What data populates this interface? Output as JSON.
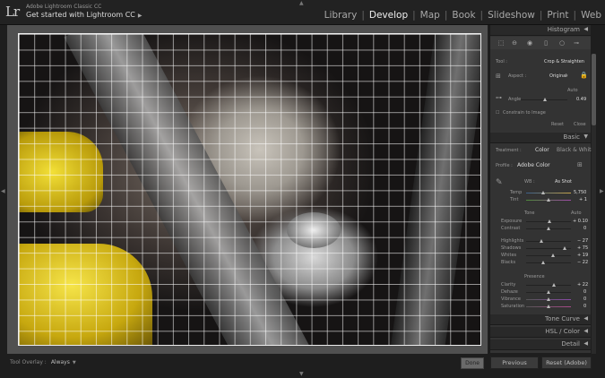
{
  "app": {
    "logo": "Lr",
    "name": "Adobe Lightroom Classic CC",
    "promo": "Get started with Lightroom CC"
  },
  "modules": [
    {
      "label": "Library",
      "active": false
    },
    {
      "label": "Develop",
      "active": true
    },
    {
      "label": "Map",
      "active": false
    },
    {
      "label": "Book",
      "active": false
    },
    {
      "label": "Slideshow",
      "active": false
    },
    {
      "label": "Print",
      "active": false
    },
    {
      "label": "Web",
      "active": false
    }
  ],
  "bottom_bar": {
    "tool_overlay_label": "Tool Overlay :",
    "tool_overlay_value": "Always",
    "done_label": "Done"
  },
  "panel": {
    "histogram": "Histogram",
    "crop": {
      "tool_label": "Tool :",
      "tool_value": "Crop & Straighten",
      "aspect_label": "Aspect :",
      "aspect_value": "Original",
      "auto_label": "Auto",
      "angle_label": "Angle",
      "angle_value": "0.49",
      "constrain_label": "Constrain to Image",
      "reset_label": "Reset",
      "close_label": "Close"
    },
    "basic": {
      "title": "Basic",
      "treatment_label": "Treatment :",
      "color_label": "Color",
      "bw_label": "Black & White",
      "profile_label": "Profile :",
      "profile_value": "Adobe Color",
      "wb_label": "WB :",
      "wb_value": "As Shot",
      "temp_label": "Temp",
      "temp_value": "5,750",
      "tint_label": "Tint",
      "tint_value": "+ 1",
      "tone_label": "Tone",
      "tone_auto": "Auto",
      "exposure_label": "Exposure",
      "exposure_value": "+ 0.10",
      "contrast_label": "Contrast",
      "contrast_value": "0",
      "highlights_label": "Highlights",
      "highlights_value": "− 27",
      "shadows_label": "Shadows",
      "shadows_value": "+ 75",
      "whites_label": "Whites",
      "whites_value": "+ 19",
      "blacks_label": "Blacks",
      "blacks_value": "− 22",
      "presence_label": "Presence",
      "clarity_label": "Clarity",
      "clarity_value": "+ 22",
      "dehaze_label": "Dehaze",
      "dehaze_value": "0",
      "vibrance_label": "Vibrance",
      "vibrance_value": "0",
      "saturation_label": "Saturation",
      "saturation_value": "0"
    },
    "tone_curve": "Tone Curve",
    "hsl": "HSL / Color",
    "detail": "Detail",
    "previous_label": "Previous",
    "reset_adobe_label": "Reset (Adobe)"
  },
  "colors": {
    "accent": "#f3e037",
    "panel_bg": "#333333",
    "window_bg": "#1e1e1e"
  }
}
